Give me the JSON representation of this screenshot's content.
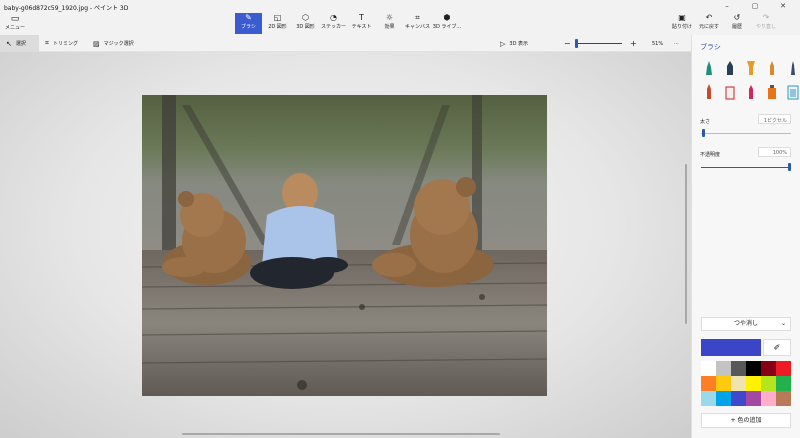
{
  "window": {
    "title": "baby-g06d872c59_1920.jpg - ペイント 3D",
    "controls": [
      "–",
      "▢",
      "✕"
    ]
  },
  "menu": {
    "label": "メニュー",
    "icon": "folder-icon"
  },
  "toolbar": {
    "tools": [
      {
        "label": "ブラシ",
        "icon": "brush-icon",
        "active": true
      },
      {
        "label": "2D 図形",
        "icon": "2d-shapes-icon"
      },
      {
        "label": "3D 図形",
        "icon": "3d-shapes-icon"
      },
      {
        "label": "ステッカー",
        "icon": "sticker-icon"
      },
      {
        "label": "テキスト",
        "icon": "text-icon"
      },
      {
        "label": "効果",
        "icon": "effects-icon"
      },
      {
        "label": "キャンバス",
        "icon": "canvas-icon"
      },
      {
        "label": "3D ライブ...",
        "icon": "3d-library-icon"
      }
    ],
    "right": [
      {
        "label": "貼り付け",
        "icon": "paste-icon"
      },
      {
        "label": "元に戻す",
        "icon": "undo-icon"
      },
      {
        "label": "履歴",
        "icon": "history-icon"
      },
      {
        "label": "やり直し",
        "icon": "redo-icon",
        "disabled": true
      }
    ]
  },
  "secondary": {
    "select_label": "選択",
    "crop_label": "トリミング",
    "magic_label": "マジック選択",
    "view3d_label": "3D 表示",
    "zoom_minus": "−",
    "zoom_plus": "+",
    "zoom_value": "51%",
    "more": "···"
  },
  "panel": {
    "title": "ブラシ",
    "size_label": "太さ",
    "size_value": "1ピクセル",
    "opacity_label": "不透明度",
    "opacity_value": "100%",
    "size_slider_fraction": 0.01,
    "opacity_slider_fraction": 1.0,
    "finish": "つや消し",
    "current_color": "#3b45c8",
    "add_color_label": "+ 色の追加",
    "swatches": [
      "#ffffff",
      "#c3c3c3",
      "#585858",
      "#000000",
      "#880015",
      "#ed1c24",
      "#ff7f27",
      "#ffc90e",
      "#efe4b0",
      "#fff200",
      "#b5e61d",
      "#22b14c",
      "#99d9ea",
      "#00a2e8",
      "#3f48cc",
      "#a349a4",
      "#ffaec9",
      "#b97a57"
    ]
  }
}
